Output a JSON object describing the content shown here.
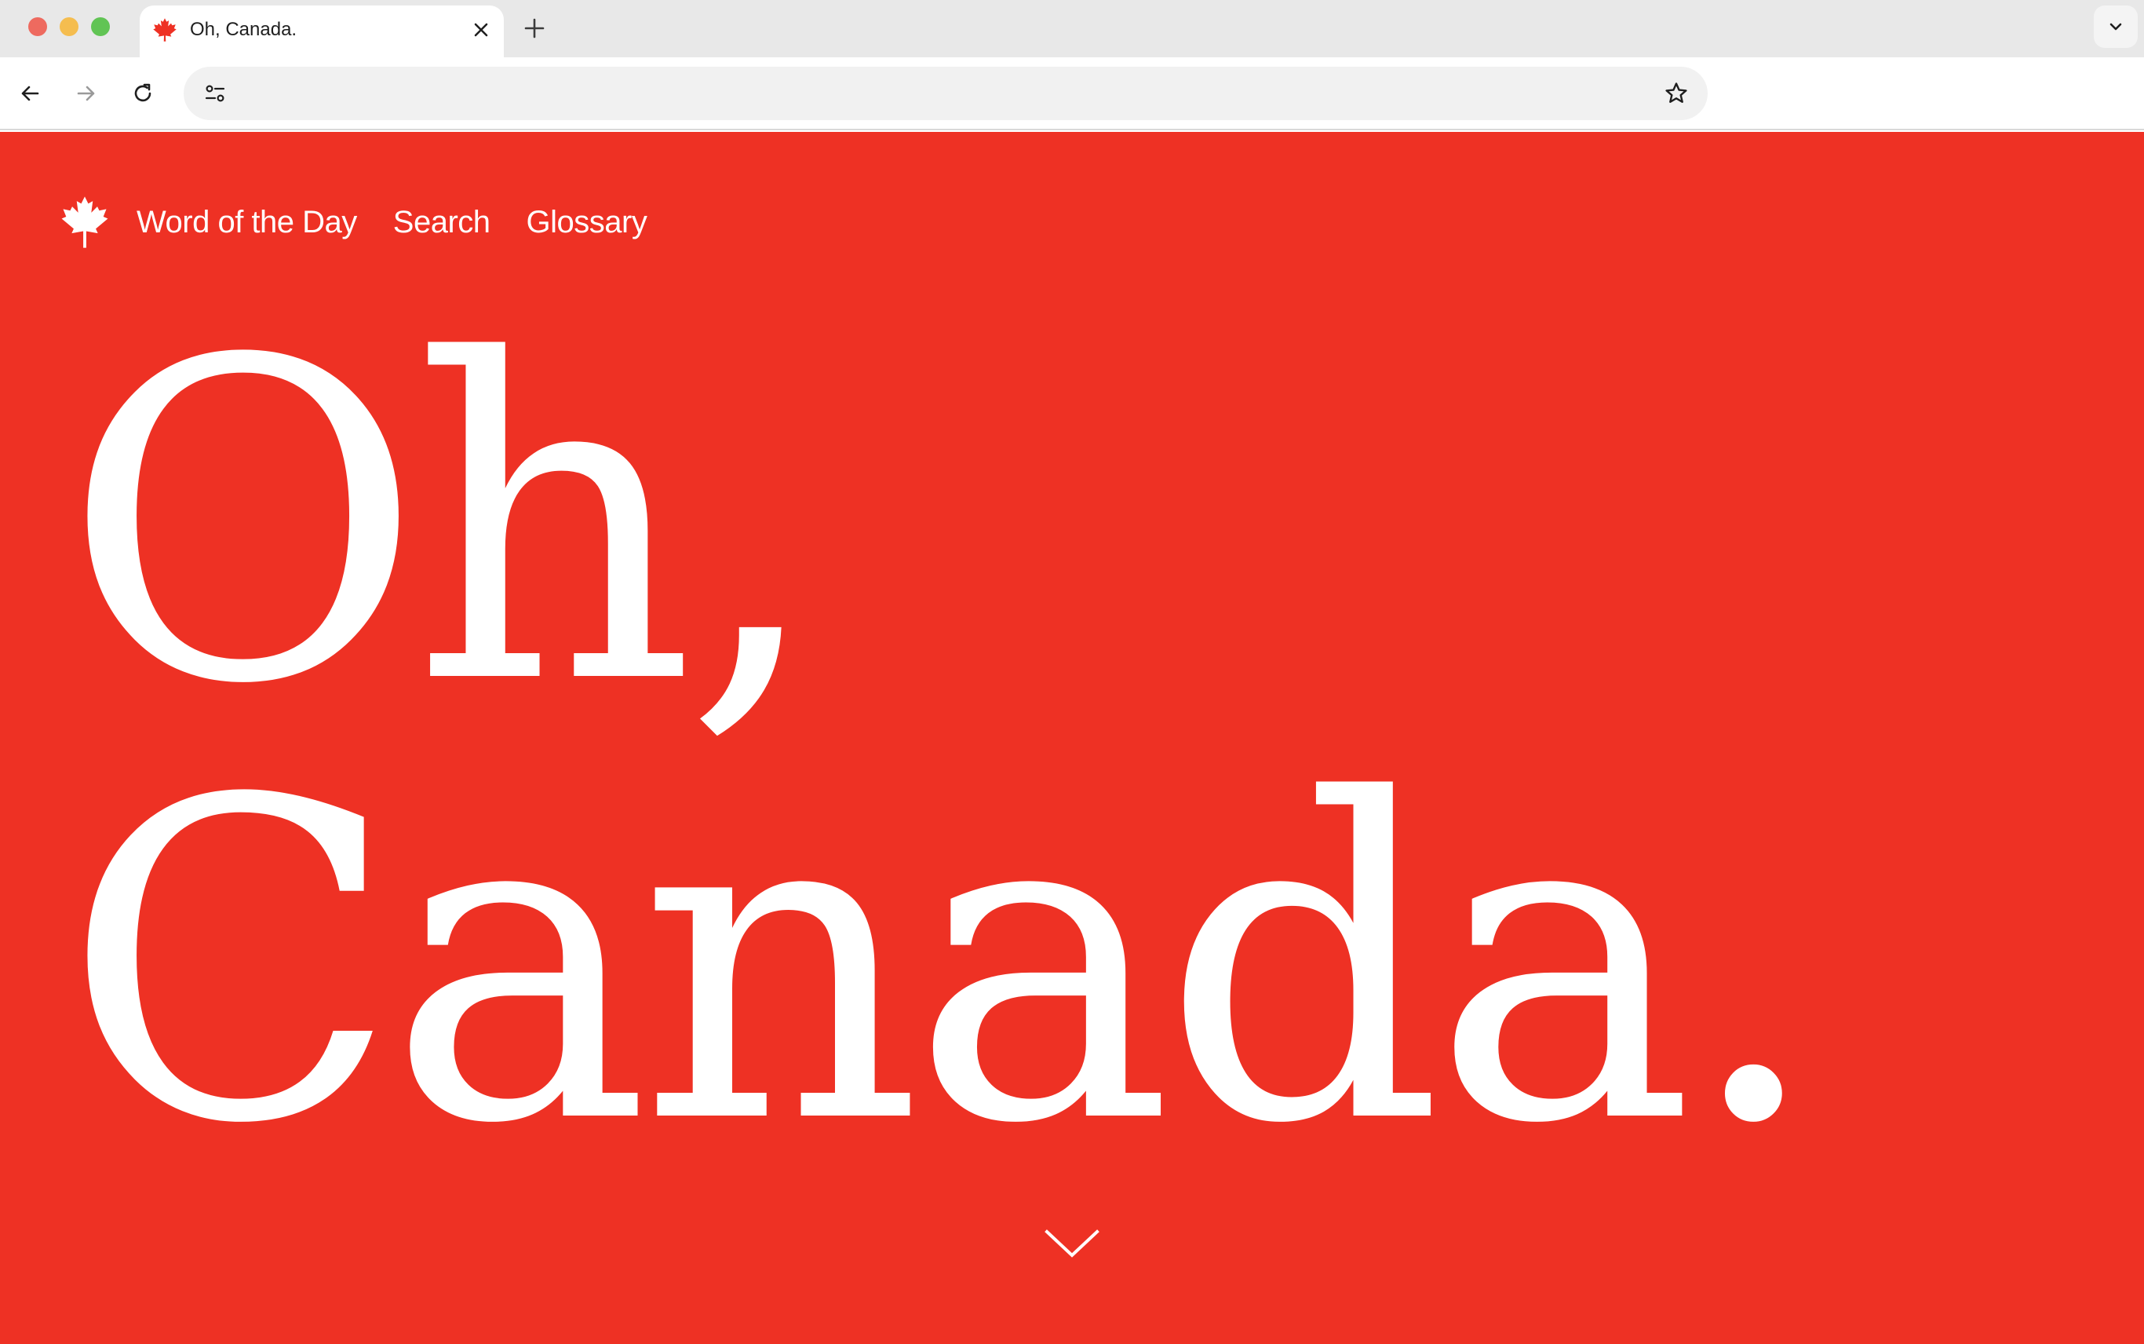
{
  "browser": {
    "tab": {
      "title": "Oh, Canada.",
      "favicon": "maple-leaf-icon"
    },
    "address_bar": {
      "value": "",
      "placeholder": ""
    }
  },
  "site": {
    "nav": {
      "logo": "maple-leaf-icon",
      "links": [
        "Word of the Day",
        "Search",
        "Glossary"
      ]
    },
    "hero": {
      "line1": "Oh,",
      "line2": "Canada."
    },
    "scroll_icon": "chevron-down-icon"
  },
  "colors": {
    "brand_red": "#ee3124",
    "text_white": "#ffffff"
  }
}
